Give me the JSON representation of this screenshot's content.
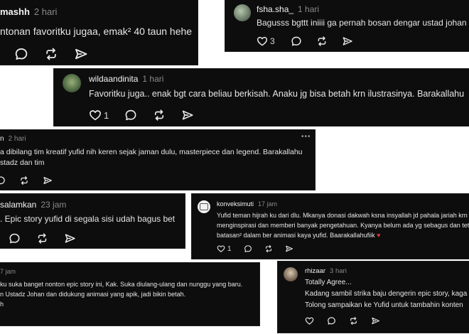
{
  "comments": [
    {
      "username": "mashh",
      "time": "2 hari",
      "text": "ntonan favoritku jugaa, emak² 40 taun hehe"
    },
    {
      "username": "fsha.sha_",
      "time": "1 hari",
      "text": "Bagusss bgttt iniiii ga pernah bosan dengar ustad johan di",
      "likes": "3"
    },
    {
      "username": "wildaandinita",
      "time": "1 hari",
      "text": "Favoritku juga.. enak bgt cara beliau berkisah. Anaku jg bisa betah krn ilustrasinya. Barakallahu",
      "likes": "1"
    },
    {
      "username": "n",
      "time": "2 hari",
      "text_lines": [
        "a dibilang tim kreatif yufid nih keren sejak jaman dulu, masterpiece dan legend. Barakallahu",
        "stadz dan tim"
      ]
    },
    {
      "username": "salamkan",
      "time": "23 jam",
      "text": ". Epic story yufid di segala sisi udah bagus bet"
    },
    {
      "username": "konveksimuti",
      "time": "17 jam",
      "text_lines": [
        "Yufid teman hijrah ku dari dlu. Mkanya donasi dakwah ksna insyallah jd pahala jariah krn t",
        "menginspirasi dan memberi banyak pengetahuan. Kyanya belum ada yg sebagus dan teta",
        "batasan² dalam ber animasi kaya yufid. Baarakallahufiik"
      ],
      "emoji": "♥",
      "likes": "1"
    },
    {
      "username": "",
      "time": "7 jam",
      "text_lines": [
        "ku suka banget nonton epic story ini, Kak. Suka diulang-ulang dan nunggu yang baru.",
        "n Ustadz Johan dan didukung animasi yang apik, jadi bikin betah.",
        "h"
      ]
    },
    {
      "username": "rhizaar",
      "time": "3 hari",
      "text_lines": [
        "Totally Agree...",
        "Kadang sambil strika baju dengerin epic story, kaga",
        "Tolong sampaikan ke Yufid untuk tambahin konten"
      ]
    }
  ],
  "colors": {
    "card_bg": "#0d0d0d",
    "text": "#e6e6e6",
    "muted": "#8a8a8a",
    "heart_accent": "#e0343a"
  },
  "icons": [
    "heart-icon",
    "comment-icon",
    "repost-icon",
    "share-icon",
    "more-icon"
  ]
}
